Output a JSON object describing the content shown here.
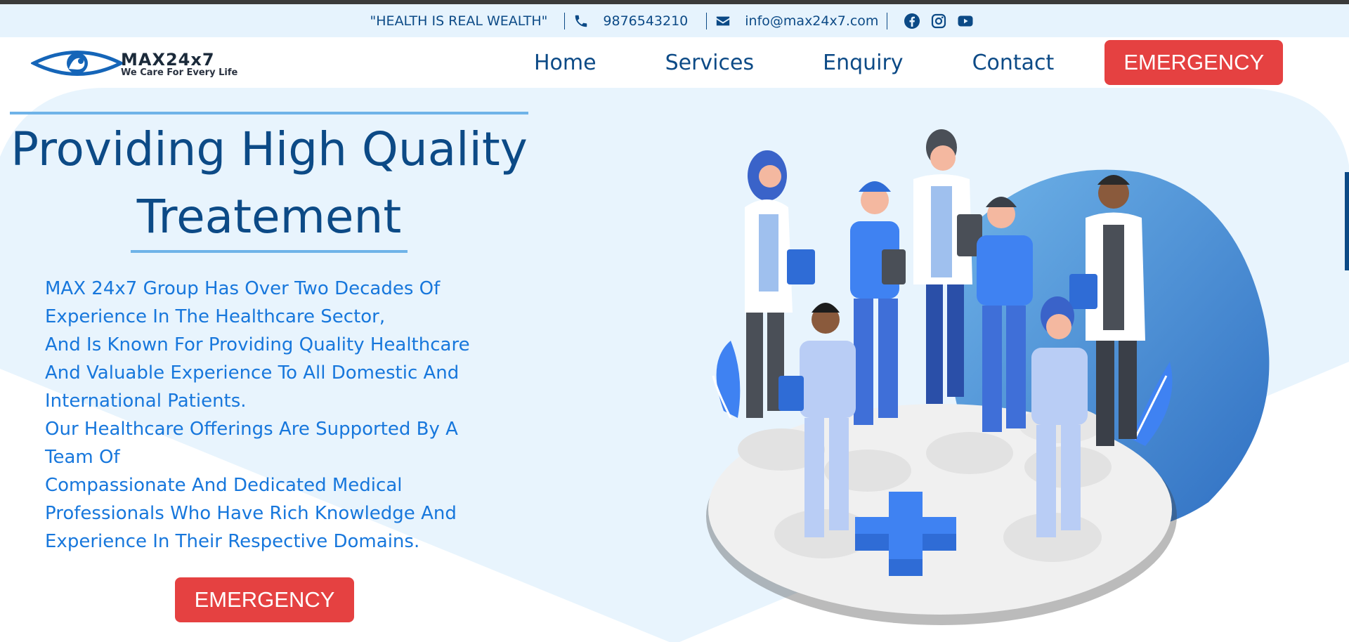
{
  "topbar": {
    "slogan": "\"HEALTH IS REAL WEALTH\"",
    "phone": "9876543210",
    "email": "info@max24x7.com",
    "icons": [
      "phone-icon",
      "mail-icon",
      "facebook-icon",
      "instagram-icon",
      "youtube-icon"
    ]
  },
  "logo": {
    "name": "MAX24x7",
    "tagline": "We Care For Every Life"
  },
  "nav": {
    "items": [
      {
        "label": "Home"
      },
      {
        "label": "Services"
      },
      {
        "label": "Enquiry"
      },
      {
        "label": "Contact"
      }
    ],
    "emergency_label": "EMERGENCY"
  },
  "hero": {
    "title_line1": "Providing High Quality",
    "title_line2": "Treatement",
    "paragraphs": [
      "MAX 24x7 Group Has Over Two Decades Of Experience In The Healthcare Sector,",
      "And Is Known For Providing Quality Healthcare And Valuable Experience To All Domestic And International Patients.",
      "Our Healthcare Offerings Are Supported By A Team Of",
      "Compassionate And Dedicated Medical Professionals Who Have Rich Knowledge And Experience In Their Respective Domains."
    ],
    "emergency_label": "EMERGENCY"
  },
  "colors": {
    "primary": "#0c4a86",
    "text_blue": "#1777dc",
    "emergency": "#e54141",
    "topbar_bg": "#e6f3fd",
    "hero_bg": "#e8f4fd",
    "accent_line": "#6fb3e8"
  }
}
